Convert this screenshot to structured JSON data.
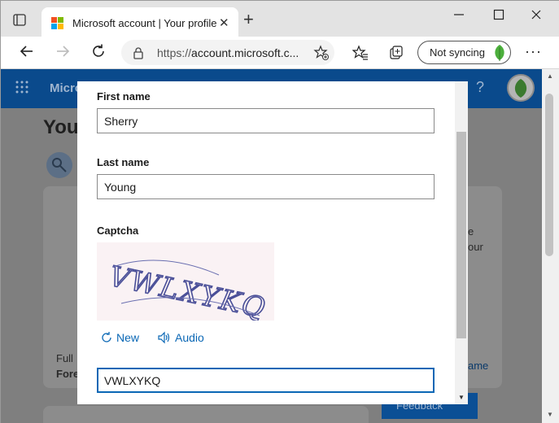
{
  "browser": {
    "tab_title": "Microsoft account | Your profile",
    "url_protocol": "https://",
    "url_host": "account.microsoft.c...",
    "sync_label": "Not syncing",
    "new_tab_symbol": "+",
    "close_tab_symbol": "✕",
    "more_symbol": "···"
  },
  "background_page": {
    "brand": "Micro",
    "title": "You",
    "text_full": "Full",
    "text_fore": "Fore",
    "text_right1": "e",
    "text_right2": "our",
    "text_right3": "ame",
    "feedback_label": "Feedback",
    "help_symbol": "?"
  },
  "dialog": {
    "first_name_label": "First name",
    "first_name_value": "Sherry",
    "last_name_label": "Last name",
    "last_name_value": "Young",
    "captcha_label": "Captcha",
    "captcha_image_text": "VWLXYKQ",
    "new_button": "New",
    "audio_button": "Audio",
    "captcha_input_value": "VWLXYKQ"
  },
  "colors": {
    "accent": "#0a67b5",
    "header_blue": "#0a4a8c",
    "leaf_green": "#4caf3c"
  }
}
